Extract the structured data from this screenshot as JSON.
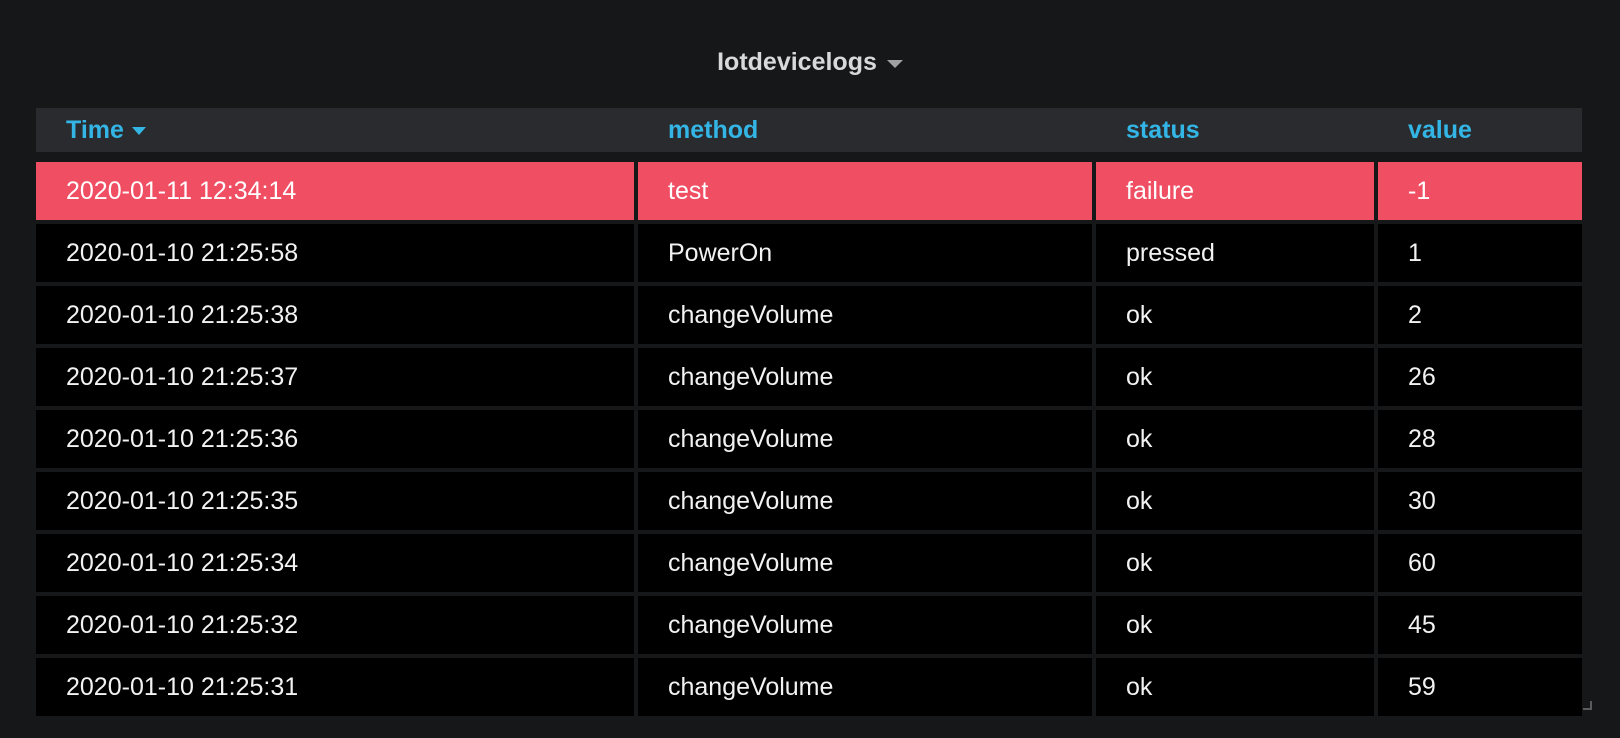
{
  "panel": {
    "title": "Iotdevicelogs"
  },
  "table": {
    "columns": [
      "Time",
      "method",
      "status",
      "value"
    ],
    "sorted_column": "Time",
    "sort_direction": "desc",
    "highlight_color": "#f04e63",
    "header_color": "#33b5e5",
    "rows": [
      [
        "2020-01-11 12:34:14",
        "test",
        "failure",
        "-1"
      ],
      [
        "2020-01-10 21:25:58",
        "PowerOn",
        "pressed",
        "1"
      ],
      [
        "2020-01-10 21:25:38",
        "changeVolume",
        "ok",
        "2"
      ],
      [
        "2020-01-10 21:25:37",
        "changeVolume",
        "ok",
        "26"
      ],
      [
        "2020-01-10 21:25:36",
        "changeVolume",
        "ok",
        "28"
      ],
      [
        "2020-01-10 21:25:35",
        "changeVolume",
        "ok",
        "30"
      ],
      [
        "2020-01-10 21:25:34",
        "changeVolume",
        "ok",
        "60"
      ],
      [
        "2020-01-10 21:25:32",
        "changeVolume",
        "ok",
        "45"
      ],
      [
        "2020-01-10 21:25:31",
        "changeVolume",
        "ok",
        "59"
      ]
    ]
  }
}
